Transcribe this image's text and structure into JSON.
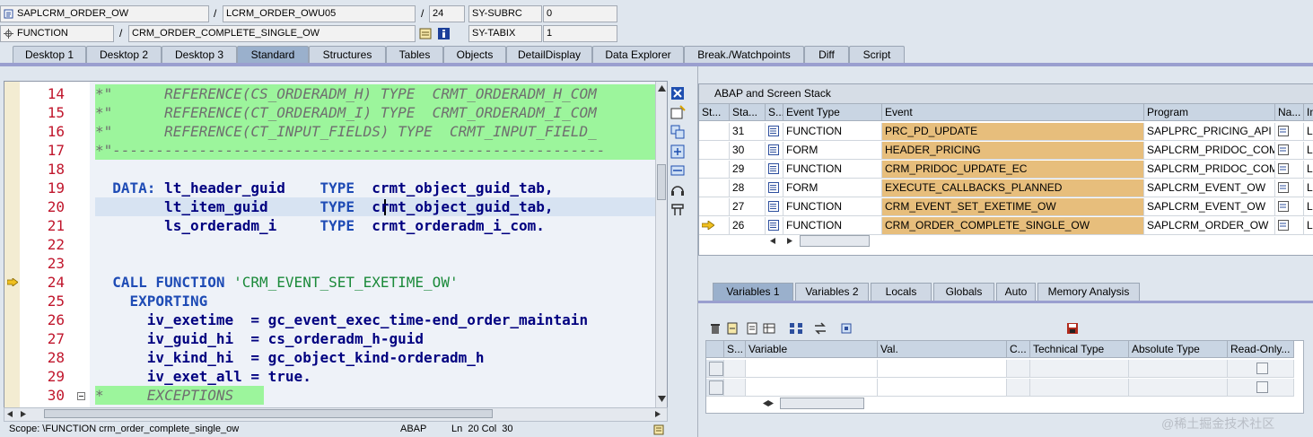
{
  "header": {
    "program_field": "SAPLCRM_ORDER_OW",
    "include_field": "LCRM_ORDER_OWU05",
    "line_field": "24",
    "sy_subrc_label": "SY-SUBRC",
    "sy_subrc_value": "0",
    "type_field": "FUNCTION",
    "name_field": "CRM_ORDER_COMPLETE_SINGLE_OW",
    "sy_tabix_label": "SY-TABIX",
    "sy_tabix_value": "1",
    "sep": "/"
  },
  "tabs": [
    "Desktop 1",
    "Desktop 2",
    "Desktop 3",
    "Standard",
    "Structures",
    "Tables",
    "Objects",
    "DetailDisplay",
    "Data Explorer",
    "Break./Watchpoints",
    "Diff",
    "Script"
  ],
  "active_tab": "Standard",
  "editor": {
    "lines": [
      {
        "n": "14",
        "segs": [
          {
            "c": "cmt",
            "t": "*\"      REFERENCE(CS_ORDERADM_H) TYPE  CRMT_ORDERADM_H_COM"
          }
        ]
      },
      {
        "n": "15",
        "segs": [
          {
            "c": "cmt",
            "t": "*\"      REFERENCE(CT_ORDERADM_I) TYPE  CRMT_ORDERADM_I_COM"
          }
        ]
      },
      {
        "n": "16",
        "segs": [
          {
            "c": "cmt",
            "t": "*\"      REFERENCE(CT_INPUT_FIELDS) TYPE  CRMT_INPUT_FIELD_"
          }
        ]
      },
      {
        "n": "17",
        "segs": [
          {
            "c": "cmt",
            "t": "*\"---------------------------------------------------------"
          }
        ]
      },
      {
        "n": "18",
        "segs": []
      },
      {
        "n": "19",
        "segs": [
          {
            "c": "kw",
            "t": "  DATA: "
          },
          {
            "c": "id",
            "t": "lt_header_guid    "
          },
          {
            "c": "kw",
            "t": "TYPE  "
          },
          {
            "c": "id",
            "t": "crmt_object_guid_tab,"
          }
        ]
      },
      {
        "n": "20",
        "segs": [
          {
            "c": "id",
            "t": "        lt_item_guid      "
          },
          {
            "c": "kw",
            "t": "TYPE  "
          },
          {
            "c": "id",
            "t": "crmt_object_guid_tab,"
          }
        ]
      },
      {
        "n": "21",
        "segs": [
          {
            "c": "id",
            "t": "        ls_orderadm_i     "
          },
          {
            "c": "kw",
            "t": "TYPE  "
          },
          {
            "c": "id",
            "t": "crmt_orderadm_i_com."
          }
        ]
      },
      {
        "n": "22",
        "segs": []
      },
      {
        "n": "23",
        "segs": []
      },
      {
        "n": "24",
        "segs": [
          {
            "c": "kw",
            "t": "  CALL FUNCTION "
          },
          {
            "c": "str",
            "t": "'CRM_EVENT_SET_EXETIME_OW'"
          }
        ]
      },
      {
        "n": "25",
        "segs": [
          {
            "c": "kw",
            "t": "    EXPORTING"
          }
        ]
      },
      {
        "n": "26",
        "segs": [
          {
            "c": "id",
            "t": "      iv_exetime  = gc_event_exec_time-end_order_maintain"
          }
        ]
      },
      {
        "n": "27",
        "segs": [
          {
            "c": "id",
            "t": "      iv_guid_hi  = cs_orderadm_h-guid"
          }
        ]
      },
      {
        "n": "28",
        "segs": [
          {
            "c": "id",
            "t": "      iv_kind_hi  = gc_object_kind-orderadm_h"
          }
        ]
      },
      {
        "n": "29",
        "segs": [
          {
            "c": "id",
            "t": "      iv_exet_all = true."
          }
        ]
      },
      {
        "n": "30",
        "segs": [
          {
            "c": "cmt",
            "t": "*     EXCEPTIONS"
          }
        ]
      }
    ]
  },
  "status": {
    "scope": "Scope: \\FUNCTION crm_order_complete_single_ow",
    "lang": "ABAP",
    "pos": "Ln  20 Col  30"
  },
  "stack": {
    "title": "ABAP and Screen Stack",
    "columns": [
      "St...",
      "Sta...",
      "S...",
      "Event Type",
      "Event",
      "Program",
      "Na...",
      "In"
    ],
    "rows": [
      {
        "level": "31",
        "type": "FUNCTION",
        "event": "PRC_PD_UPDATE",
        "program": "SAPLPRC_PRICING_API",
        "incl": "LP"
      },
      {
        "level": "30",
        "type": "FORM",
        "event": "HEADER_PRICING",
        "program": "SAPLCRM_PRIDOC_COM...",
        "incl": "LC"
      },
      {
        "level": "29",
        "type": "FUNCTION",
        "event": "CRM_PRIDOC_UPDATE_EC",
        "program": "SAPLCRM_PRIDOC_COM...",
        "incl": "LC"
      },
      {
        "level": "28",
        "type": "FORM",
        "event": "EXECUTE_CALLBACKS_PLANNED",
        "program": "SAPLCRM_EVENT_OW",
        "incl": "LC"
      },
      {
        "level": "27",
        "type": "FUNCTION",
        "event": "CRM_EVENT_SET_EXETIME_OW",
        "program": "SAPLCRM_EVENT_OW",
        "incl": "LC"
      },
      {
        "level": "26",
        "type": "FUNCTION",
        "event": "CRM_ORDER_COMPLETE_SINGLE_OW",
        "program": "SAPLCRM_ORDER_OW",
        "incl": "LC"
      }
    ]
  },
  "var_tabs": [
    "Variables 1",
    "Variables 2",
    "Locals",
    "Globals",
    "Auto",
    "Memory Analysis"
  ],
  "var_active": "Variables 1",
  "vars": {
    "columns": [
      "S...",
      "Variable",
      "Val.",
      "C...",
      "Technical Type",
      "Absolute Type",
      "Read-Only..."
    ]
  },
  "watermark": "@稀土掘金技术社区",
  "colors": {
    "comment_bg": "#9cf59c",
    "event_bg": "#e7be7c",
    "line_no": "#c0162c",
    "keyword": "#1e4bb5"
  }
}
